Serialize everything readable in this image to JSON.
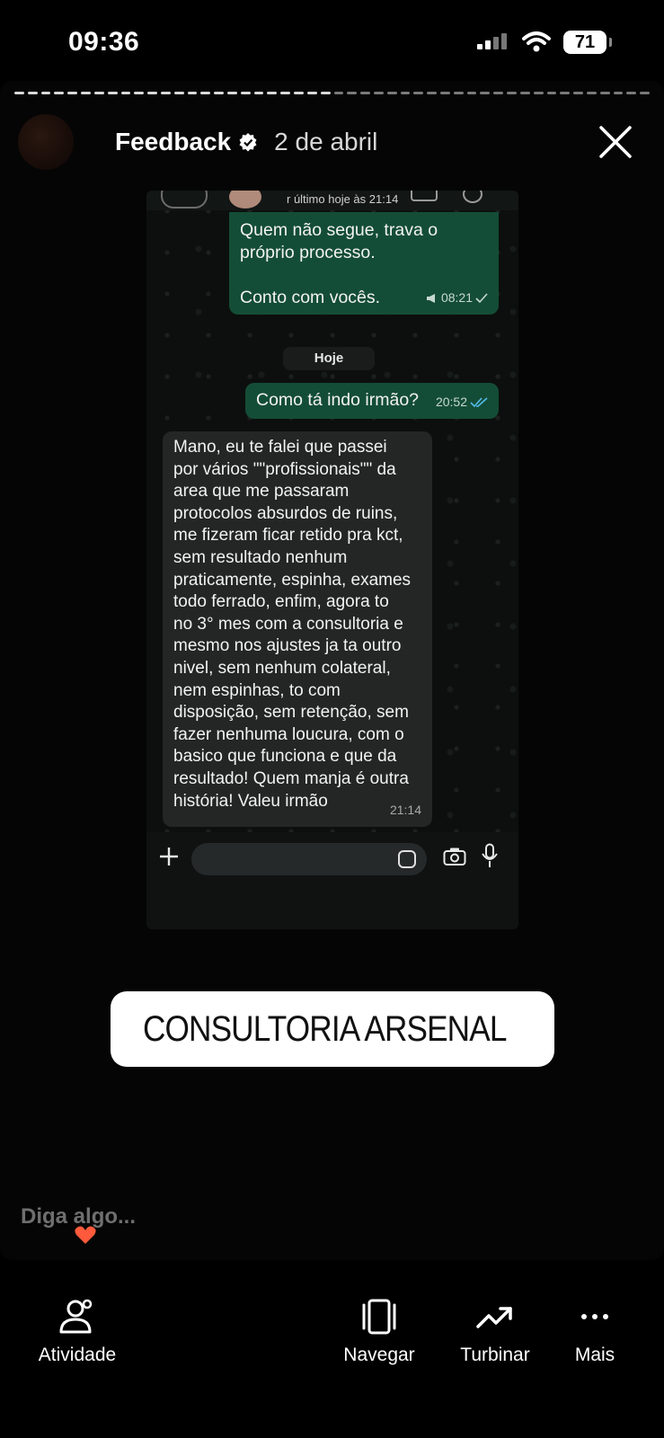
{
  "status_bar": {
    "time": "09:36",
    "battery": "71"
  },
  "story": {
    "account_name": "Feedback",
    "date": "2 de abril"
  },
  "chat": {
    "last_seen": "r último hoje às 21:14",
    "messages": [
      {
        "direction": "outgoing",
        "line1": "Quem não segue, trava o",
        "line2": "próprio processo.",
        "line3": "Conto com vocês.",
        "time": "08:21"
      },
      {
        "direction": "outgoing",
        "text": "Como tá indo irmão?",
        "time": "20:52"
      },
      {
        "direction": "incoming",
        "lines": [
          "Mano, eu te falei que passei",
          "por vários \"\"profissionais\"\" da",
          "area que me passaram",
          "protocolos absurdos de ruins,",
          "me fizeram ficar retido pra kct,",
          "sem resultado nenhum",
          "praticamente, espinha, exames",
          "todo ferrado, enfim, agora to",
          "no 3° mes com a consultoria e",
          "mesmo nos ajustes ja ta outro",
          "nivel, sem nenhum colateral,",
          "nem espinhas, to com",
          "disposição, sem retenção, sem",
          "fazer nenhuma loucura, com o",
          "basico que funciona e que da",
          "resultado! Quem manja é outra",
          "história! Valeu irmão"
        ],
        "time": "21:14"
      }
    ],
    "day_label": "Hoje"
  },
  "link_sticker": {
    "label": "CONSULTORIA ARSENAL"
  },
  "reply": {
    "placeholder": "Diga algo..."
  },
  "nav": {
    "activity": "Atividade",
    "browse": "Navegar",
    "boost": "Turbinar",
    "more": "Mais"
  }
}
